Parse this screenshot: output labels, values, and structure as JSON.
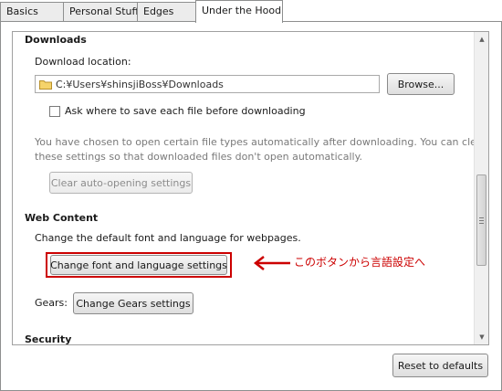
{
  "tabs": [
    {
      "label": "Basics",
      "active": false
    },
    {
      "label": "Personal Stuff",
      "active": false
    },
    {
      "label": "Edges",
      "active": false
    },
    {
      "label": "Under the Hood",
      "active": true
    }
  ],
  "downloads": {
    "heading": "Downloads",
    "location_label": "Download location:",
    "location_value": "C:¥Users¥shinsjiBoss¥Downloads",
    "browse_label": "Browse...",
    "ask_label": "Ask where to save each file before downloading",
    "ask_checked": false,
    "auto_open_line1": "You have chosen to open certain file types automatically after downloading. You can clear",
    "auto_open_line2": "these settings so that downloaded files don't open automatically.",
    "clear_label": "Clear auto-opening settings"
  },
  "web_content": {
    "heading": "Web Content",
    "description": "Change the default font and language for webpages.",
    "font_button_label": "Change font and language settings"
  },
  "gears": {
    "label": "Gears:",
    "button_label": "Change Gears settings"
  },
  "security": {
    "heading": "Security"
  },
  "annotation": {
    "text": "このボタンから言語設定へ",
    "color": "#cc0000"
  },
  "footer": {
    "reset_label": "Reset to defaults"
  },
  "icons": {
    "folder": "folder-icon",
    "arrow": "arrow-left-icon"
  }
}
